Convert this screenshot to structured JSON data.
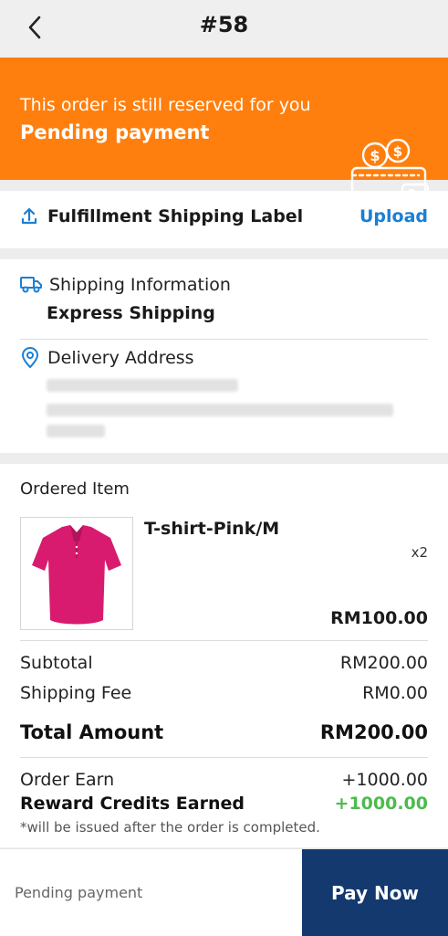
{
  "header": {
    "title": "#58"
  },
  "banner": {
    "subtitle": "This order is still reserved for you",
    "status": "Pending payment",
    "icon": "wallet-coins-icon",
    "color": "#ff7f0e"
  },
  "shipping_label": {
    "label": "Fulfillment Shipping Label",
    "action": "Upload",
    "icon": "upload-icon"
  },
  "shipping": {
    "label": "Shipping Information",
    "method": "Express Shipping",
    "icon": "truck-icon"
  },
  "delivery": {
    "label": "Delivery Address",
    "icon": "location-pin-icon"
  },
  "order": {
    "section_title": "Ordered Item",
    "item": {
      "name": "T-shirt-Pink/M",
      "qty": "x2",
      "price": "RM100.00"
    },
    "subtotal_label": "Subtotal",
    "subtotal": "RM200.00",
    "shipping_fee_label": "Shipping Fee",
    "shipping_fee": "RM0.00",
    "total_label": "Total Amount",
    "total": "RM200.00",
    "earn_label": "Order Earn",
    "earn": "+1000.00",
    "reward_label": "Reward Credits Earned",
    "reward": "+1000.00",
    "note": "*will be issued after the order is completed."
  },
  "footer": {
    "status": "Pending payment",
    "pay_label": "Pay Now",
    "pay_color": "#13396e"
  }
}
